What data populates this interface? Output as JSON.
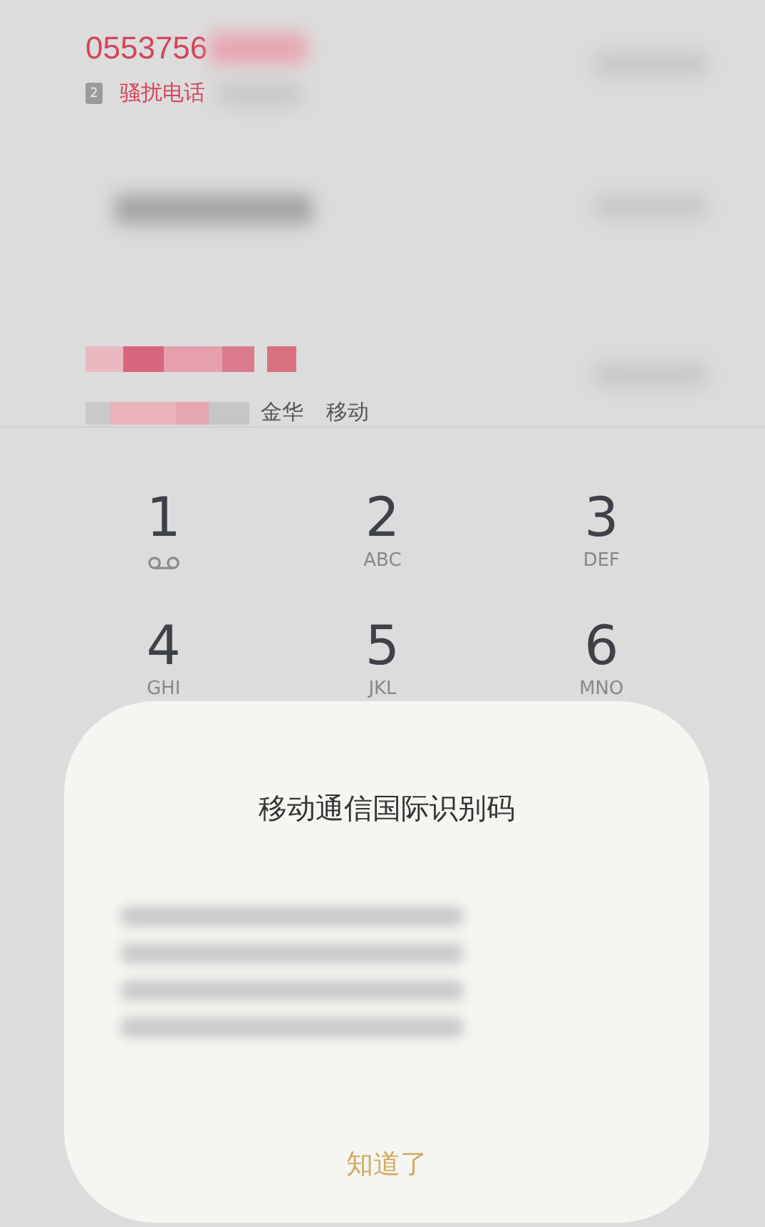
{
  "call_log": [
    {
      "kind": "number",
      "number": "0553756",
      "sim": "2",
      "tag": "骚扰电话"
    },
    {
      "kind": "hidden"
    },
    {
      "kind": "location",
      "location": "金华",
      "carrier": "移动"
    }
  ],
  "keypad": [
    {
      "digit": "1",
      "kind": "voicemail"
    },
    {
      "digit": "2",
      "letters": "ABC"
    },
    {
      "digit": "3",
      "letters": "DEF"
    },
    {
      "digit": "4",
      "letters": "GHI"
    },
    {
      "digit": "5",
      "letters": "JKL"
    },
    {
      "digit": "6",
      "letters": "MNO"
    }
  ],
  "dialog": {
    "title": "移动通信国际识别码",
    "button": "知道了"
  }
}
